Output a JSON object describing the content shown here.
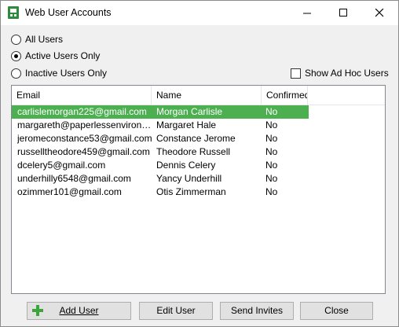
{
  "window": {
    "title": "Web User Accounts"
  },
  "filters": {
    "all_users": "All Users",
    "active_users_only": "Active Users Only",
    "inactive_users_only": "Inactive Users Only",
    "selected": "Active Users Only",
    "show_ad_hoc_users": "Show Ad Hoc Users",
    "show_ad_hoc_checked": false
  },
  "table": {
    "columns": [
      "Email",
      "Name",
      "Confirmed"
    ],
    "rows": [
      {
        "email": "carlislemorgan225@gmail.com",
        "name": "Morgan Carlisle",
        "confirmed": "No"
      },
      {
        "email": "margareth@paperlessenvironmen...",
        "name": "Margaret Hale",
        "confirmed": "No"
      },
      {
        "email": "jeromeconstance53@gmail.com",
        "name": "Constance Jerome",
        "confirmed": "No"
      },
      {
        "email": "russelltheodore459@gmail.com",
        "name": "Theodore Russell",
        "confirmed": "No"
      },
      {
        "email": "dcelery5@gmail.com",
        "name": "Dennis Celery",
        "confirmed": "No"
      },
      {
        "email": "underhilly6548@gmail.com",
        "name": "Yancy Underhill",
        "confirmed": "No"
      },
      {
        "email": "ozimmer101@gmail.com",
        "name": "Otis Zimmerman",
        "confirmed": "No"
      }
    ],
    "selected_row": 0
  },
  "buttons": {
    "add_user": "Add User",
    "edit_user": "Edit User",
    "send_invites": "Send Invites",
    "close": "Close"
  },
  "colors": {
    "selection": "#4caf50",
    "plus_icon": "#3aa53a"
  }
}
